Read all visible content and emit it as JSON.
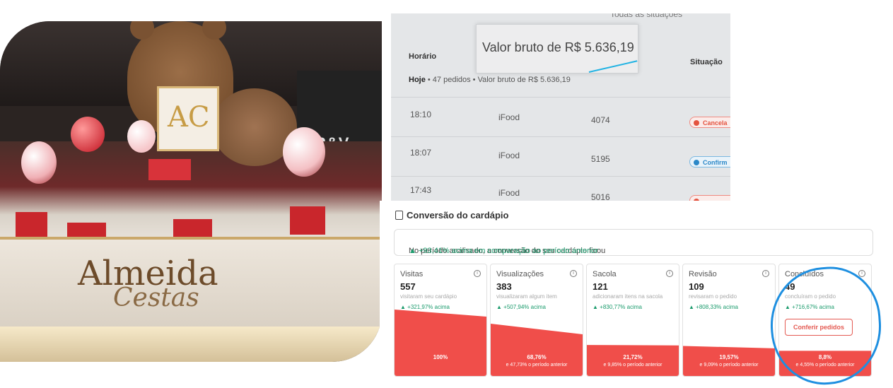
{
  "photo": {
    "store_sign": "R&V",
    "brand_line1": "Almeida",
    "brand_line2": "Cestas",
    "logo_letters": "AC"
  },
  "orders": {
    "top_cut_text": "Todas as situações",
    "col_horario": "Horário",
    "col_situacao": "Situação",
    "zoom_text": "Valor bruto de R$ 5.636,19",
    "summary_day": "Hoje",
    "summary_rest": " • 47 pedidos • Valor bruto de R$ 5.636,19",
    "rows": [
      {
        "time": "18:10",
        "app": "iFood",
        "code": "4074",
        "status": "Cancela",
        "type": "cancel"
      },
      {
        "time": "18:07",
        "app": "iFood",
        "code": "5195",
        "status": "Confirm",
        "type": "confirm"
      },
      {
        "time": "17:43",
        "app": "iFood",
        "code": "5016",
        "status": "",
        "type": "cancel"
      }
    ],
    "colors": {
      "highlight_arrow": "#22b3e3"
    }
  },
  "panel": {
    "title": "Conversão do cardápio",
    "banner_text": "No período analisado, a conversão do seu cardápio ficou",
    "banner_up": "▲ +93,41% acima em comparação ao período anterior",
    "cards": [
      {
        "title": "Visitas",
        "num": "557",
        "sub": "visitaram seu cardápio",
        "growth": "▲ +321,97% acima",
        "pct": "100%",
        "prev": "",
        "fill": 1.0
      },
      {
        "title": "Visualizações",
        "num": "383",
        "sub": "visualizaram algum item",
        "growth": "▲ +507,94% acima",
        "pct": "68,76%",
        "prev": "e 47,73% o período anterior",
        "fill": 0.6876
      },
      {
        "title": "Sacola",
        "num": "121",
        "sub": "adicionaram itens na sacola",
        "growth": "▲ +830,77% acima",
        "pct": "21,72%",
        "prev": "e 9,85% o período anterior",
        "fill": 0.2172
      },
      {
        "title": "Revisão",
        "num": "109",
        "sub": "revisaram o pedido",
        "growth": "▲ +808,33% acima",
        "pct": "19,57%",
        "prev": "e 9,09% o período anterior",
        "fill": 0.1957
      },
      {
        "title": "Concluídos",
        "num": "49",
        "sub": "concluíram o pedido",
        "growth": "▲ +716,67% acima",
        "pct": "8,8%",
        "prev": "e 4,55% o período anterior",
        "fill": 0.088,
        "button": "Conferir pedidos"
      }
    ],
    "colors": {
      "funnel": "#f04e4a",
      "growth": "#1a9b6c",
      "circle": "#1e8fe0"
    }
  }
}
